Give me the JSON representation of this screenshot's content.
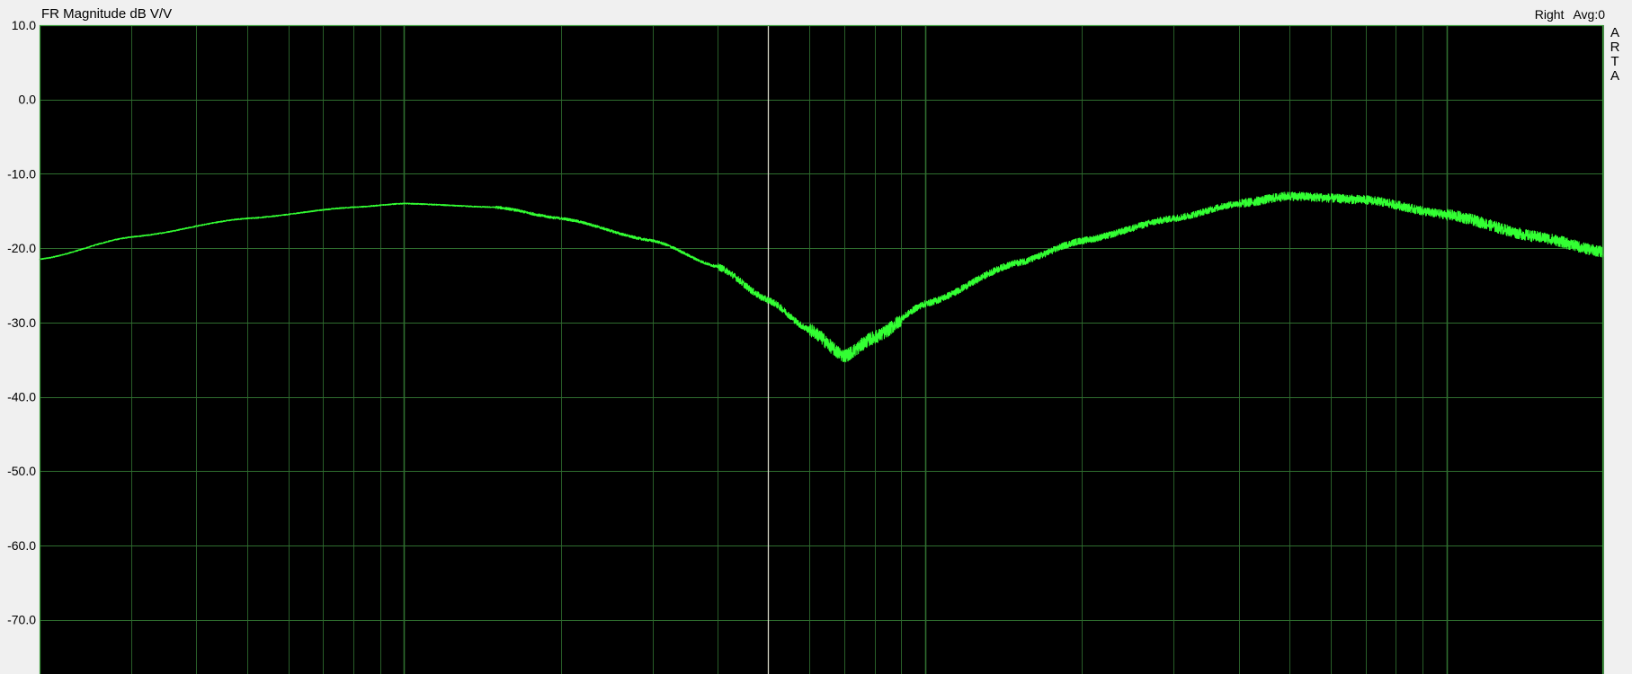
{
  "window": {
    "title": "FR Magnitude dB V/V",
    "channel": "Right",
    "averages": "Avg:0",
    "brand": "ARTA"
  },
  "colors": {
    "plot_background": "#000000",
    "grid": "#2f6e2f",
    "trace": "#33ff33",
    "cursor": "#d8d8c8",
    "frame": "#3b9b3b"
  },
  "chart_data": {
    "type": "line",
    "title": "FR Magnitude dB V/V",
    "xlabel": "",
    "ylabel": "",
    "x_scale": "log",
    "xlim": [
      20,
      20000
    ],
    "ylim": [
      -80,
      10
    ],
    "yticks": [
      10,
      0,
      -10,
      -20,
      -30,
      -40,
      -50,
      -60,
      -70
    ],
    "ytick_labels": [
      "10.0",
      "0.0",
      "-10.0",
      "-20.0",
      "-30.0",
      "-40.0",
      "-50.0",
      "-60.0",
      "-70.0"
    ],
    "cursor_x": 500,
    "grid": true,
    "series": [
      {
        "x": [
          20,
          30,
          50,
          80,
          100,
          150,
          200,
          300,
          400,
          500,
          600,
          700,
          800,
          1000,
          1500,
          2000,
          3000,
          4000,
          5000,
          7000,
          10000,
          15000,
          20000
        ],
        "y": [
          -21.5,
          -18.5,
          -16.0,
          -14.5,
          -14.0,
          -14.5,
          -16.0,
          -19.0,
          -22.5,
          -27.0,
          -31.0,
          -34.5,
          -32.0,
          -27.5,
          -22.0,
          -19.0,
          -16.0,
          -14.0,
          -13.0,
          -13.5,
          -15.5,
          -18.5,
          -20.5
        ]
      }
    ]
  }
}
